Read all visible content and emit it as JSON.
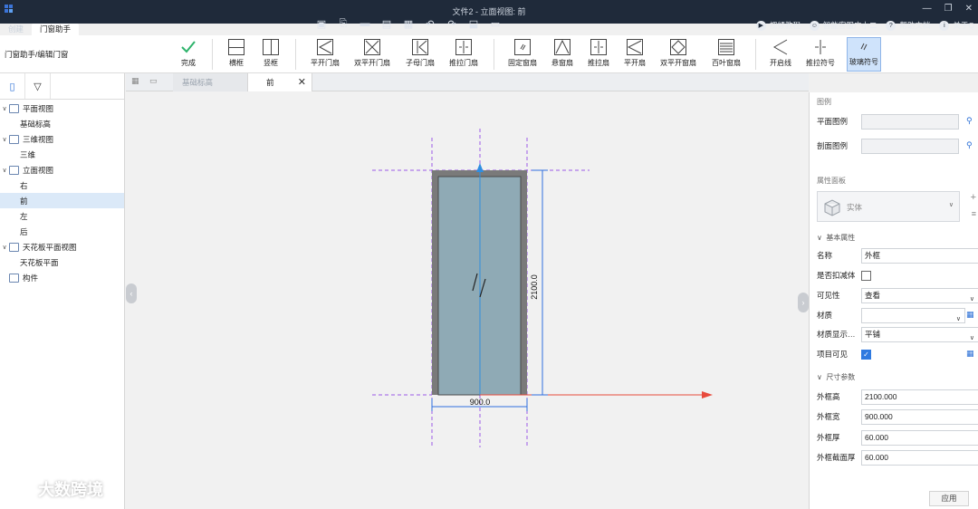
{
  "app": {
    "title": "文件2 - 立面视图: 前"
  },
  "help_links": [
    "视频教程",
    "智能客服广小二",
    "帮助文档",
    "关于Q"
  ],
  "ribbon_tabs": [
    "创建",
    "门窗助手"
  ],
  "ribbon": {
    "breadcrumb": "门窗助手/编辑门窗",
    "buttons": [
      "完成",
      "横框",
      "竖框",
      "平开门扇",
      "双平开门扇",
      "子母门扇",
      "推拉门扇",
      "固定窗扇",
      "悬窗扇",
      "推拉扇",
      "平开扇",
      "双平开窗扇",
      "百叶窗扇",
      "开启线",
      "推拉符号",
      "玻璃符号"
    ]
  },
  "tree": [
    {
      "label": "平面视图",
      "level": 0,
      "expanded": true
    },
    {
      "label": "基础标高",
      "level": 1
    },
    {
      "label": "三维视图",
      "level": 0,
      "expanded": true
    },
    {
      "label": "三维",
      "level": 1
    },
    {
      "label": "立面视图",
      "level": 0,
      "expanded": true
    },
    {
      "label": "右",
      "level": 1
    },
    {
      "label": "前",
      "level": 1,
      "selected": true
    },
    {
      "label": "左",
      "level": 1
    },
    {
      "label": "后",
      "level": 1
    },
    {
      "label": "天花板平面视图",
      "level": 0,
      "expanded": true
    },
    {
      "label": "天花板平面",
      "level": 1
    },
    {
      "label": "构件",
      "level": 0
    }
  ],
  "doc_tabs": {
    "inactive": "基础标高",
    "active": "前"
  },
  "drawing": {
    "width_dim": "900.0",
    "height_dim": "2100.0"
  },
  "right_panel": {
    "legend_title": "图例",
    "plan_legend": "平面图例",
    "section_legend": "剖面图例",
    "props_title": "属性面板",
    "type_name": "实体",
    "basic_group": "基本属性",
    "size_group": "尺寸参数",
    "props": {
      "name_label": "名称",
      "name_value": "外框",
      "deduct_label": "是否扣减体",
      "visibility_label": "可见性",
      "visibility_value": "查看",
      "material_label": "材质",
      "material_value": "",
      "material_display_label": "材质显示…",
      "material_display_value": "平铺",
      "item_visible_label": "项目可见"
    },
    "size": {
      "height_label": "外框高",
      "height_value": "2100.000",
      "width_label": "外框宽",
      "width_value": "900.000",
      "thick_label": "外框厚",
      "thick_value": "60.000",
      "section_label": "外框截面厚",
      "section_value": "60.000"
    },
    "apply": "应用"
  },
  "watermark": "大数跨境",
  "colors": {
    "titlebar": "#1f2a3a",
    "accent": "#2f7ae0",
    "frame": "#7a7a7a",
    "glass": "#8faab5",
    "dash": "#9b59e8",
    "axis_red": "#e84a3c",
    "axis_blue": "#2f8ee0"
  }
}
